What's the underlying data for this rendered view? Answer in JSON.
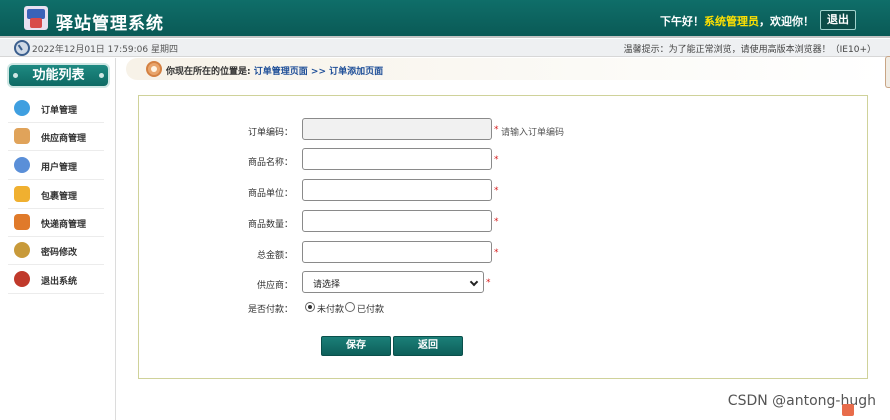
{
  "header": {
    "title": "驿站管理系统",
    "greeting_prefix": "下午好！",
    "role": "系统管理员",
    "greeting_suffix": "，欢迎你！",
    "logout_label": "退出"
  },
  "status": {
    "datetime": "2022年12月01日 17:59:06 星期四",
    "tip": "温馨提示：为了能正常浏览，请使用高版本浏览器！（IE10+）"
  },
  "sidebar": {
    "title": "功能列表",
    "items": [
      {
        "label": "订单管理",
        "icon": "order-icon",
        "color": "#3f9fe0"
      },
      {
        "label": "供应商管理",
        "icon": "supplier-truck-icon",
        "color": "#e0a35a"
      },
      {
        "label": "用户管理",
        "icon": "user-icon",
        "color": "#5a8fd8"
      },
      {
        "label": "包裹管理",
        "icon": "package-icon",
        "color": "#f0b030"
      },
      {
        "label": "快递商管理",
        "icon": "house-icon",
        "color": "#e07a2a"
      },
      {
        "label": "密码修改",
        "icon": "key-icon",
        "color": "#c89a3a"
      },
      {
        "label": "退出系统",
        "icon": "exit-icon",
        "color": "#c0392b"
      }
    ]
  },
  "breadcrumb": {
    "prefix": "你现在所在的位置是:",
    "link1": "订单管理页面",
    "sep": " >> ",
    "link2": "订单添加页面"
  },
  "form": {
    "order_code_label": "订单编码：",
    "order_code_hint": "请输入订单编码",
    "product_name_label": "商品名称：",
    "product_unit_label": "商品单位：",
    "product_count_label": "商品数量：",
    "total_label": "总金额：",
    "supplier_label": "供应商：",
    "supplier_value": "请选择",
    "paid_label": "是否付款：",
    "unpaid_option": "未付款",
    "paid_option": "已付款",
    "required_mark": "*",
    "save_label": "保存",
    "back_label": "返回"
  },
  "watermark": "CSDN @antong-hugh",
  "colors": {
    "accent": "#0d6b66",
    "link": "#1f4f98",
    "required": "#d61c1c"
  }
}
